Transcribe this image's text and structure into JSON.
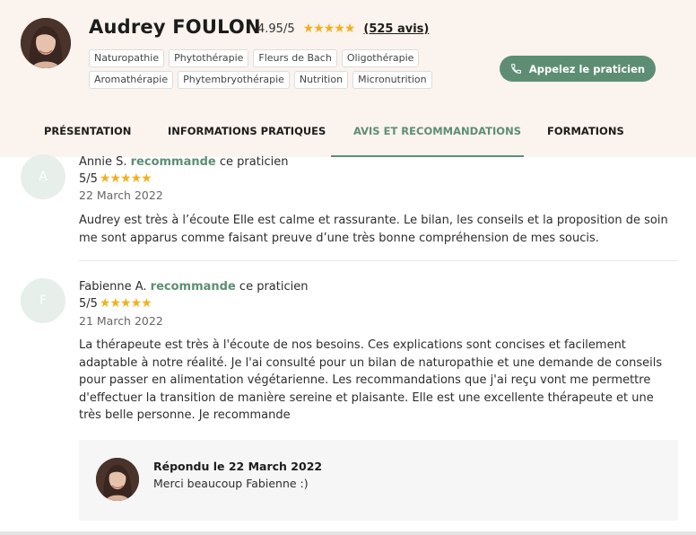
{
  "practitioner": {
    "name": "Audrey FOULON",
    "rating": "4.95/5",
    "stars": "★★★★★",
    "reviews_count": "(525 avis)",
    "tags_row1": [
      "Naturopathie",
      "Phytothérapie",
      "Fleurs de Bach",
      "Oligothérapie"
    ],
    "tags_row2": [
      "Aromathérapie",
      "Phytembryothérapie",
      "Nutrition",
      "Micronutrition"
    ],
    "call_button": "Appelez le praticien"
  },
  "tabs": [
    {
      "label": "PRÉSENTATION"
    },
    {
      "label": "INFORMATIONS PRATIQUES"
    },
    {
      "label": "AVIS ET RECOMMANDATIONS",
      "active": true
    },
    {
      "label": "FORMATIONS"
    }
  ],
  "reviews": [
    {
      "initial": "A",
      "author": "Annie S.",
      "recommends": "recommande",
      "suffix": "ce praticien",
      "score": "5/5",
      "stars": "★★★★★",
      "date": "22 March 2022",
      "text": "Audrey est très à l’écoute Elle est calme et rassurante. Le bilan, les conseils et la proposition de soin me sont apparus comme faisant preuve d’une très bonne compréhension de mes soucis."
    },
    {
      "initial": "F",
      "author": "Fabienne A.",
      "recommends": "recommande",
      "suffix": "ce praticien",
      "score": "5/5",
      "stars": "★★★★★",
      "date": "21 March 2022",
      "text": "La thérapeute est très à l'écoute de nos besoins. Ces explications sont concises et facilement adaptable à notre réalité. Je l'ai consulté pour un bilan de naturopathie et une demande de conseils pour passer en alimentation végétarienne. Les recommandations que j'ai reçu vont me permettre d'effectuer la transition de manière sereine et plaisante. Elle est une excellente thérapeute et une très belle personne. Je recommande",
      "reply": {
        "title": "Répondu le 22 March 2022",
        "text": "Merci beaucoup Fabienne :)"
      }
    }
  ],
  "colors": {
    "accent": "#5d8e74",
    "header_bg": "#faf3ee",
    "star": "#f2b01e"
  }
}
